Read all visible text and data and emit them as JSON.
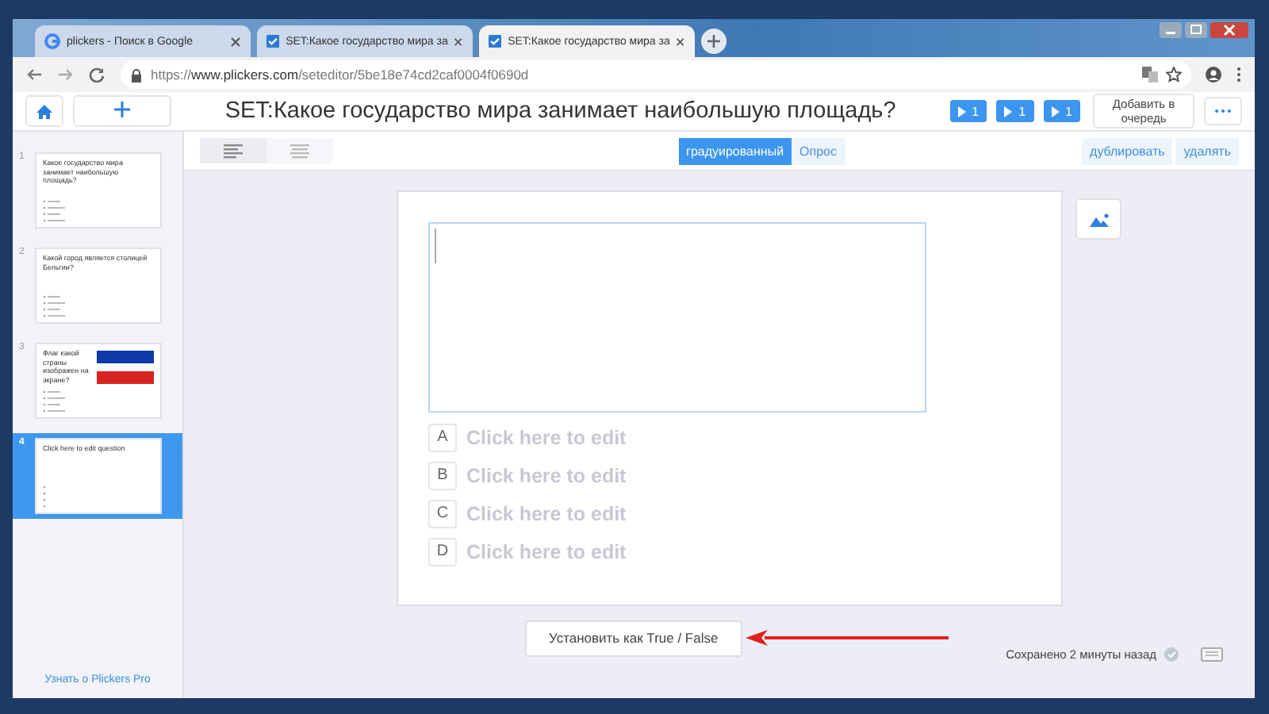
{
  "browser": {
    "tabs": [
      {
        "kind": "google",
        "title": "plickers - Поиск в Google",
        "selected": false
      },
      {
        "kind": "check",
        "title": "SET:Какое государство мира за",
        "selected": false
      },
      {
        "kind": "check",
        "title": "SET:Какое государство мира за",
        "selected": true
      }
    ],
    "url": {
      "scheme": "https://",
      "host": "www.plickers.com",
      "path": "/seteditor/5be18e74cd2caf0004f0690d"
    }
  },
  "top_bar": {
    "title": "SET:Какое государство мира занимает наибольшую площадь?",
    "play_buttons": [
      {
        "label": "1"
      },
      {
        "label": "1"
      },
      {
        "label": "1"
      }
    ],
    "queue_button": "Добавить в очередь"
  },
  "sub_bar": {
    "layouts": [
      {
        "kind": "full",
        "selected": true
      },
      {
        "kind": "centered",
        "selected": false
      }
    ],
    "question_types": [
      {
        "label": "градуированный",
        "selected": true
      },
      {
        "label": "Опрос",
        "selected": false
      }
    ],
    "actions": [
      "дублировать",
      "удалять"
    ]
  },
  "sidebar": {
    "slides": [
      {
        "number": "1",
        "question": "Какое государство мира занимает наибольшую площадь?",
        "kind": "text",
        "selected": false
      },
      {
        "number": "2",
        "question": "Какой город является столицей Бельгии?",
        "kind": "text",
        "selected": false
      },
      {
        "number": "3",
        "question": "Флаг какой страны изображен на экране?",
        "kind": "flag",
        "selected": false
      },
      {
        "number": "4",
        "question": "Click here to edit question",
        "kind": "text",
        "selected": true
      }
    ],
    "pro_link": "Узнать о Plickers Pro"
  },
  "editor": {
    "choices": [
      {
        "letter": "A",
        "placeholder": "Click here to edit"
      },
      {
        "letter": "B",
        "placeholder": "Click here to edit"
      },
      {
        "letter": "C",
        "placeholder": "Click here to edit"
      },
      {
        "letter": "D",
        "placeholder": "Click here to edit"
      }
    ],
    "true_false_button": "Установить как True / False",
    "saved_status": "Сохранено 2 минуты назад"
  }
}
